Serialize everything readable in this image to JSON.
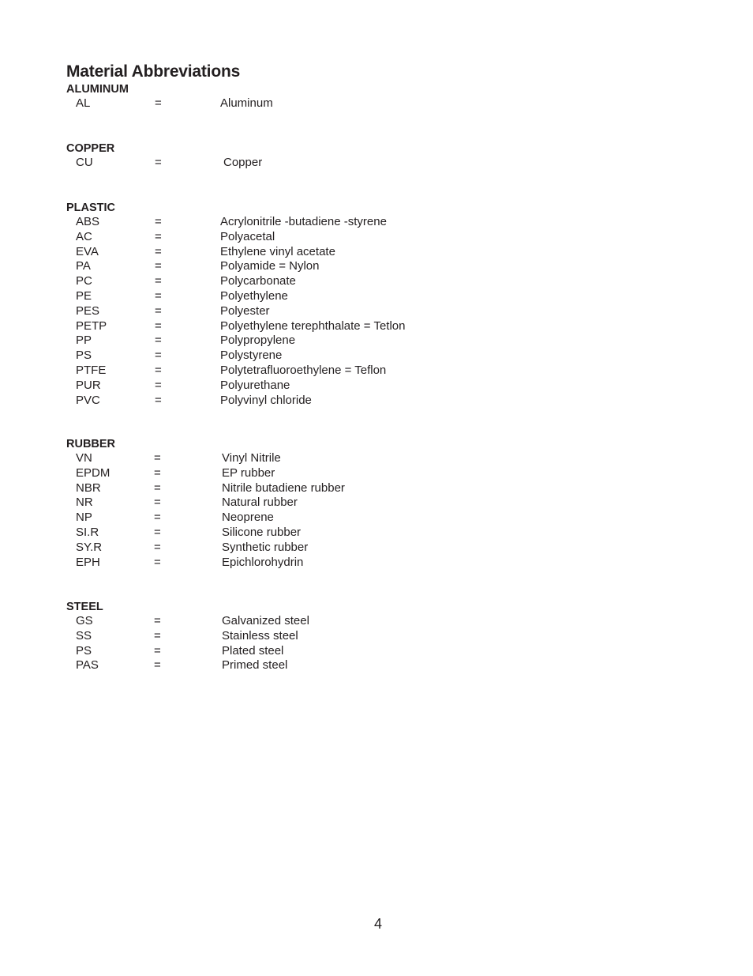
{
  "title": "Material Abbreviations",
  "sections": {
    "aluminum": {
      "heading": "ALUMINUM",
      "entries": [
        {
          "abbr": "AL",
          "eq": "=",
          "meaning": "Aluminum"
        }
      ]
    },
    "copper": {
      "heading": "COPPER",
      "entries": [
        {
          "abbr": "CU",
          "eq": "=",
          "meaning": "Copper"
        }
      ]
    },
    "plastic": {
      "heading": "PLASTIC",
      "entries": [
        {
          "abbr": "ABS",
          "eq": "=",
          "meaning": "Acrylonitrile -butadiene -styrene"
        },
        {
          "abbr": "AC",
          "eq": "=",
          "meaning": "Polyacetal"
        },
        {
          "abbr": "EVA",
          "eq": "=",
          "meaning": "Ethylene vinyl acetate"
        },
        {
          "abbr": "PA",
          "eq": "=",
          "meaning": "Polyamide = Nylon"
        },
        {
          "abbr": "PC",
          "eq": "=",
          "meaning": "Polycarbonate"
        },
        {
          "abbr": "PE",
          "eq": "=",
          "meaning": "Polyethylene"
        },
        {
          "abbr": "PES",
          "eq": "=",
          "meaning": "Polyester"
        },
        {
          "abbr": "PETP",
          "eq": "=",
          "meaning": "Polyethylene terephthalate = Tetlon"
        },
        {
          "abbr": "PP",
          "eq": "=",
          "meaning": "Polypropylene"
        },
        {
          "abbr": "PS",
          "eq": "=",
          "meaning": "Polystyrene"
        },
        {
          "abbr": "PTFE",
          "eq": "=",
          "meaning": "Polytetrafluoroethylene = Teflon"
        },
        {
          "abbr": "PUR",
          "eq": "=",
          "meaning": "Polyurethane"
        },
        {
          "abbr": "PVC",
          "eq": "=",
          "meaning": "Polyvinyl chloride"
        }
      ]
    },
    "rubber": {
      "heading": "RUBBER",
      "entries": [
        {
          "abbr": "VN",
          "eq": "=",
          "meaning": "Vinyl Nitrile"
        },
        {
          "abbr": "EPDM",
          "eq": "=",
          "meaning": "EP rubber"
        },
        {
          "abbr": "NBR",
          "eq": "=",
          "meaning": "Nitrile butadiene rubber"
        },
        {
          "abbr": "NR",
          "eq": "=",
          "meaning": "Natural rubber"
        },
        {
          "abbr": "NP",
          "eq": "=",
          "meaning": "Neoprene"
        },
        {
          "abbr": "SI.R",
          "eq": "=",
          "meaning": "Silicone rubber"
        },
        {
          "abbr": "SY.R",
          "eq": "=",
          "meaning": "Synthetic rubber"
        },
        {
          "abbr": "EPH",
          "eq": "=",
          "meaning": "Epichlorohydrin"
        }
      ]
    },
    "steel": {
      "heading": "STEEL",
      "entries": [
        {
          "abbr": "GS",
          "eq": "=",
          "meaning": "Galvanized steel"
        },
        {
          "abbr": "SS",
          "eq": "=",
          "meaning": "Stainless steel"
        },
        {
          "abbr": "PS",
          "eq": "=",
          "meaning": "Plated steel"
        },
        {
          "abbr": "PAS",
          "eq": "=",
          "meaning": "Primed steel"
        }
      ]
    }
  },
  "page_number": "4"
}
